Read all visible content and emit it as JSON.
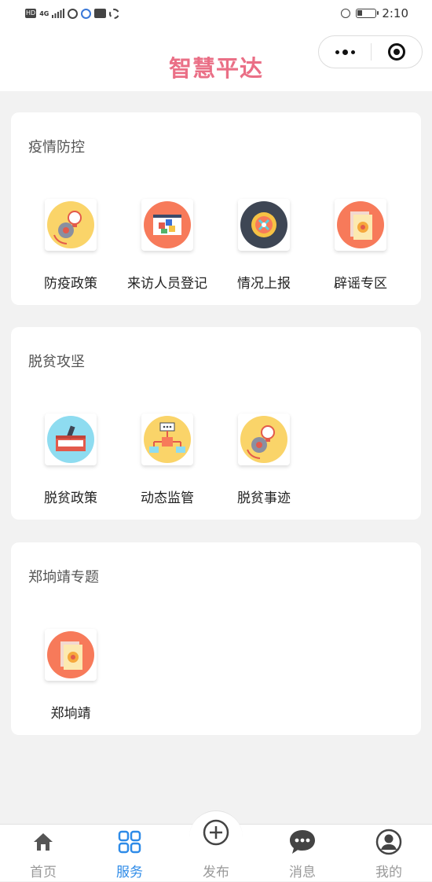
{
  "status_bar": {
    "left_icons": [
      "HD",
      "4G",
      "signal-icon",
      "app-icon-1",
      "app-icon-2",
      "app-icon-3",
      "app-icon-4"
    ],
    "hd_label": "HD",
    "network_label": "4G",
    "time": "2:10"
  },
  "header": {
    "title": "智慧平达",
    "title_color": "#ea6f86"
  },
  "sections": [
    {
      "title": "疫情防控",
      "items": [
        {
          "label": "防疫政策",
          "icon": "lightbulb-gear-icon"
        },
        {
          "label": "来访人员登记",
          "icon": "cubes-board-icon"
        },
        {
          "label": "情况上报",
          "icon": "compass-arrows-icon"
        },
        {
          "label": "辟谣专区",
          "icon": "document-gear-icon"
        }
      ]
    },
    {
      "title": "脱贫攻坚",
      "items": [
        {
          "label": "脱贫政策",
          "icon": "toolbox-icon"
        },
        {
          "label": "动态监管",
          "icon": "network-chart-icon"
        },
        {
          "label": "脱贫事迹",
          "icon": "lightbulb-gear-icon"
        }
      ]
    },
    {
      "title": "郑垧靖专题",
      "items": [
        {
          "label": "郑垧靖",
          "icon": "document-gear-icon"
        }
      ]
    }
  ],
  "tabbar": {
    "active_color": "#2e8be8",
    "inactive_color": "#999999",
    "tabs": [
      {
        "label": "首页",
        "icon": "home-icon",
        "active": false
      },
      {
        "label": "服务",
        "icon": "grid-icon",
        "active": true
      },
      {
        "label": "发布",
        "icon": "plus-circle-icon",
        "active": false
      },
      {
        "label": "消息",
        "icon": "chat-bubble-icon",
        "active": false
      },
      {
        "label": "我的",
        "icon": "user-icon",
        "active": false
      }
    ]
  }
}
